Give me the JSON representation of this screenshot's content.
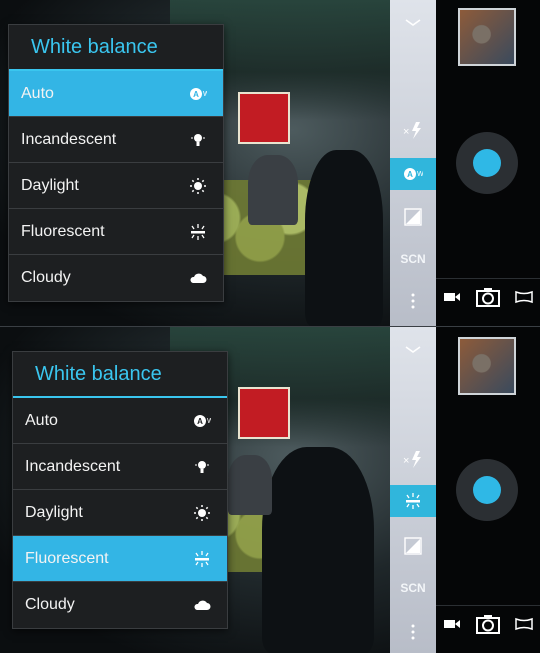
{
  "panels": [
    {
      "menu": {
        "title": "White balance",
        "items": [
          {
            "label": "Auto",
            "icon": "auto-wb-icon",
            "selected": true
          },
          {
            "label": "Incandescent",
            "icon": "incandescent-icon",
            "selected": false
          },
          {
            "label": "Daylight",
            "icon": "daylight-icon",
            "selected": false
          },
          {
            "label": "Fluorescent",
            "icon": "fluorescent-icon",
            "selected": false
          },
          {
            "label": "Cloudy",
            "icon": "cloudy-icon",
            "selected": false
          }
        ]
      },
      "strip": {
        "scene_label": "SCN",
        "active_control": "auto-wb"
      }
    },
    {
      "menu": {
        "title": "White balance",
        "items": [
          {
            "label": "Auto",
            "icon": "auto-wb-icon",
            "selected": false
          },
          {
            "label": "Incandescent",
            "icon": "incandescent-icon",
            "selected": false
          },
          {
            "label": "Daylight",
            "icon": "daylight-icon",
            "selected": false
          },
          {
            "label": "Fluorescent",
            "icon": "fluorescent-icon",
            "selected": true
          },
          {
            "label": "Cloudy",
            "icon": "cloudy-icon",
            "selected": false
          }
        ]
      },
      "strip": {
        "scene_label": "SCN",
        "active_control": "fluorescent-wb"
      }
    }
  ],
  "colors": {
    "accent": "#33b5e5",
    "menu_bg": "#1d1f21",
    "title": "#3ac6ef"
  }
}
